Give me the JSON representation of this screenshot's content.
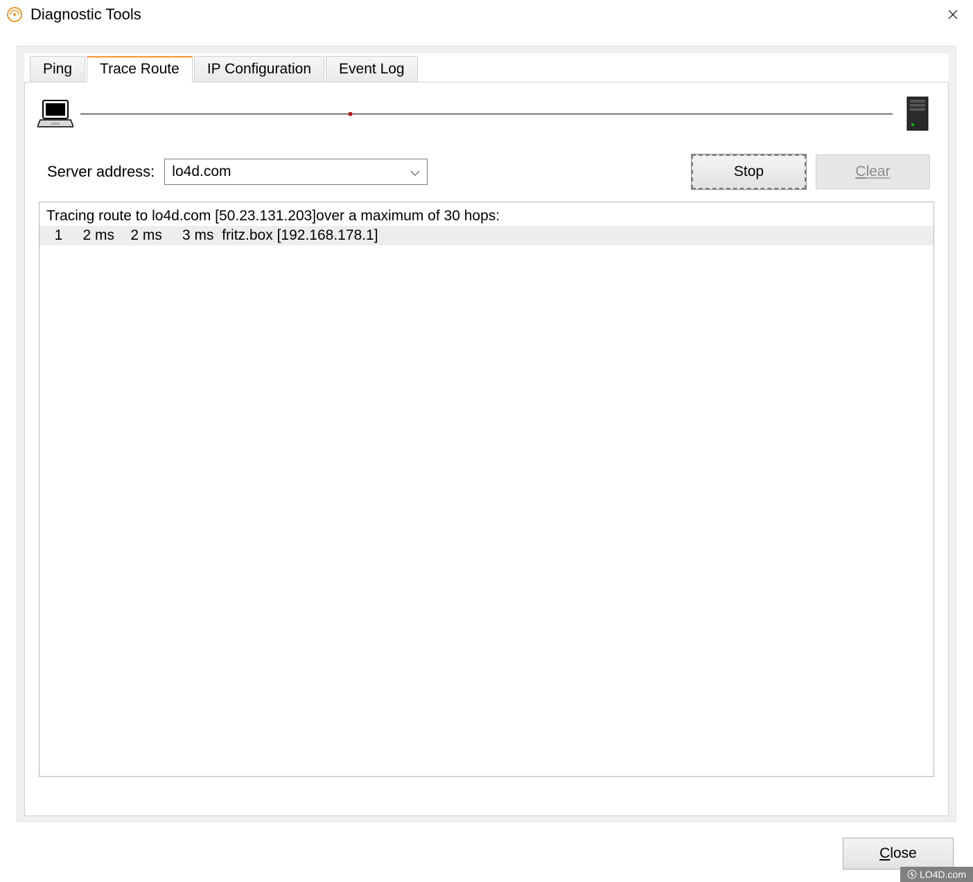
{
  "window": {
    "title": "Diagnostic Tools"
  },
  "tabs": {
    "items": [
      {
        "label": "Ping",
        "active": false
      },
      {
        "label": "Trace Route",
        "active": true
      },
      {
        "label": "IP Configuration",
        "active": false
      },
      {
        "label": "Event Log",
        "active": false
      }
    ]
  },
  "trace": {
    "server_label": "Server address:",
    "server_value": "lo4d.com",
    "stop_label": "Stop",
    "clear_label": "Clear",
    "output_header": "Tracing route to lo4d.com [50.23.131.203]over a maximum of 30 hops:",
    "rows": [
      "  1     2 ms    2 ms     3 ms  fritz.box [192.168.178.1]"
    ]
  },
  "footer": {
    "close_label": "Close"
  },
  "watermark": {
    "text": "LO4D.com"
  }
}
